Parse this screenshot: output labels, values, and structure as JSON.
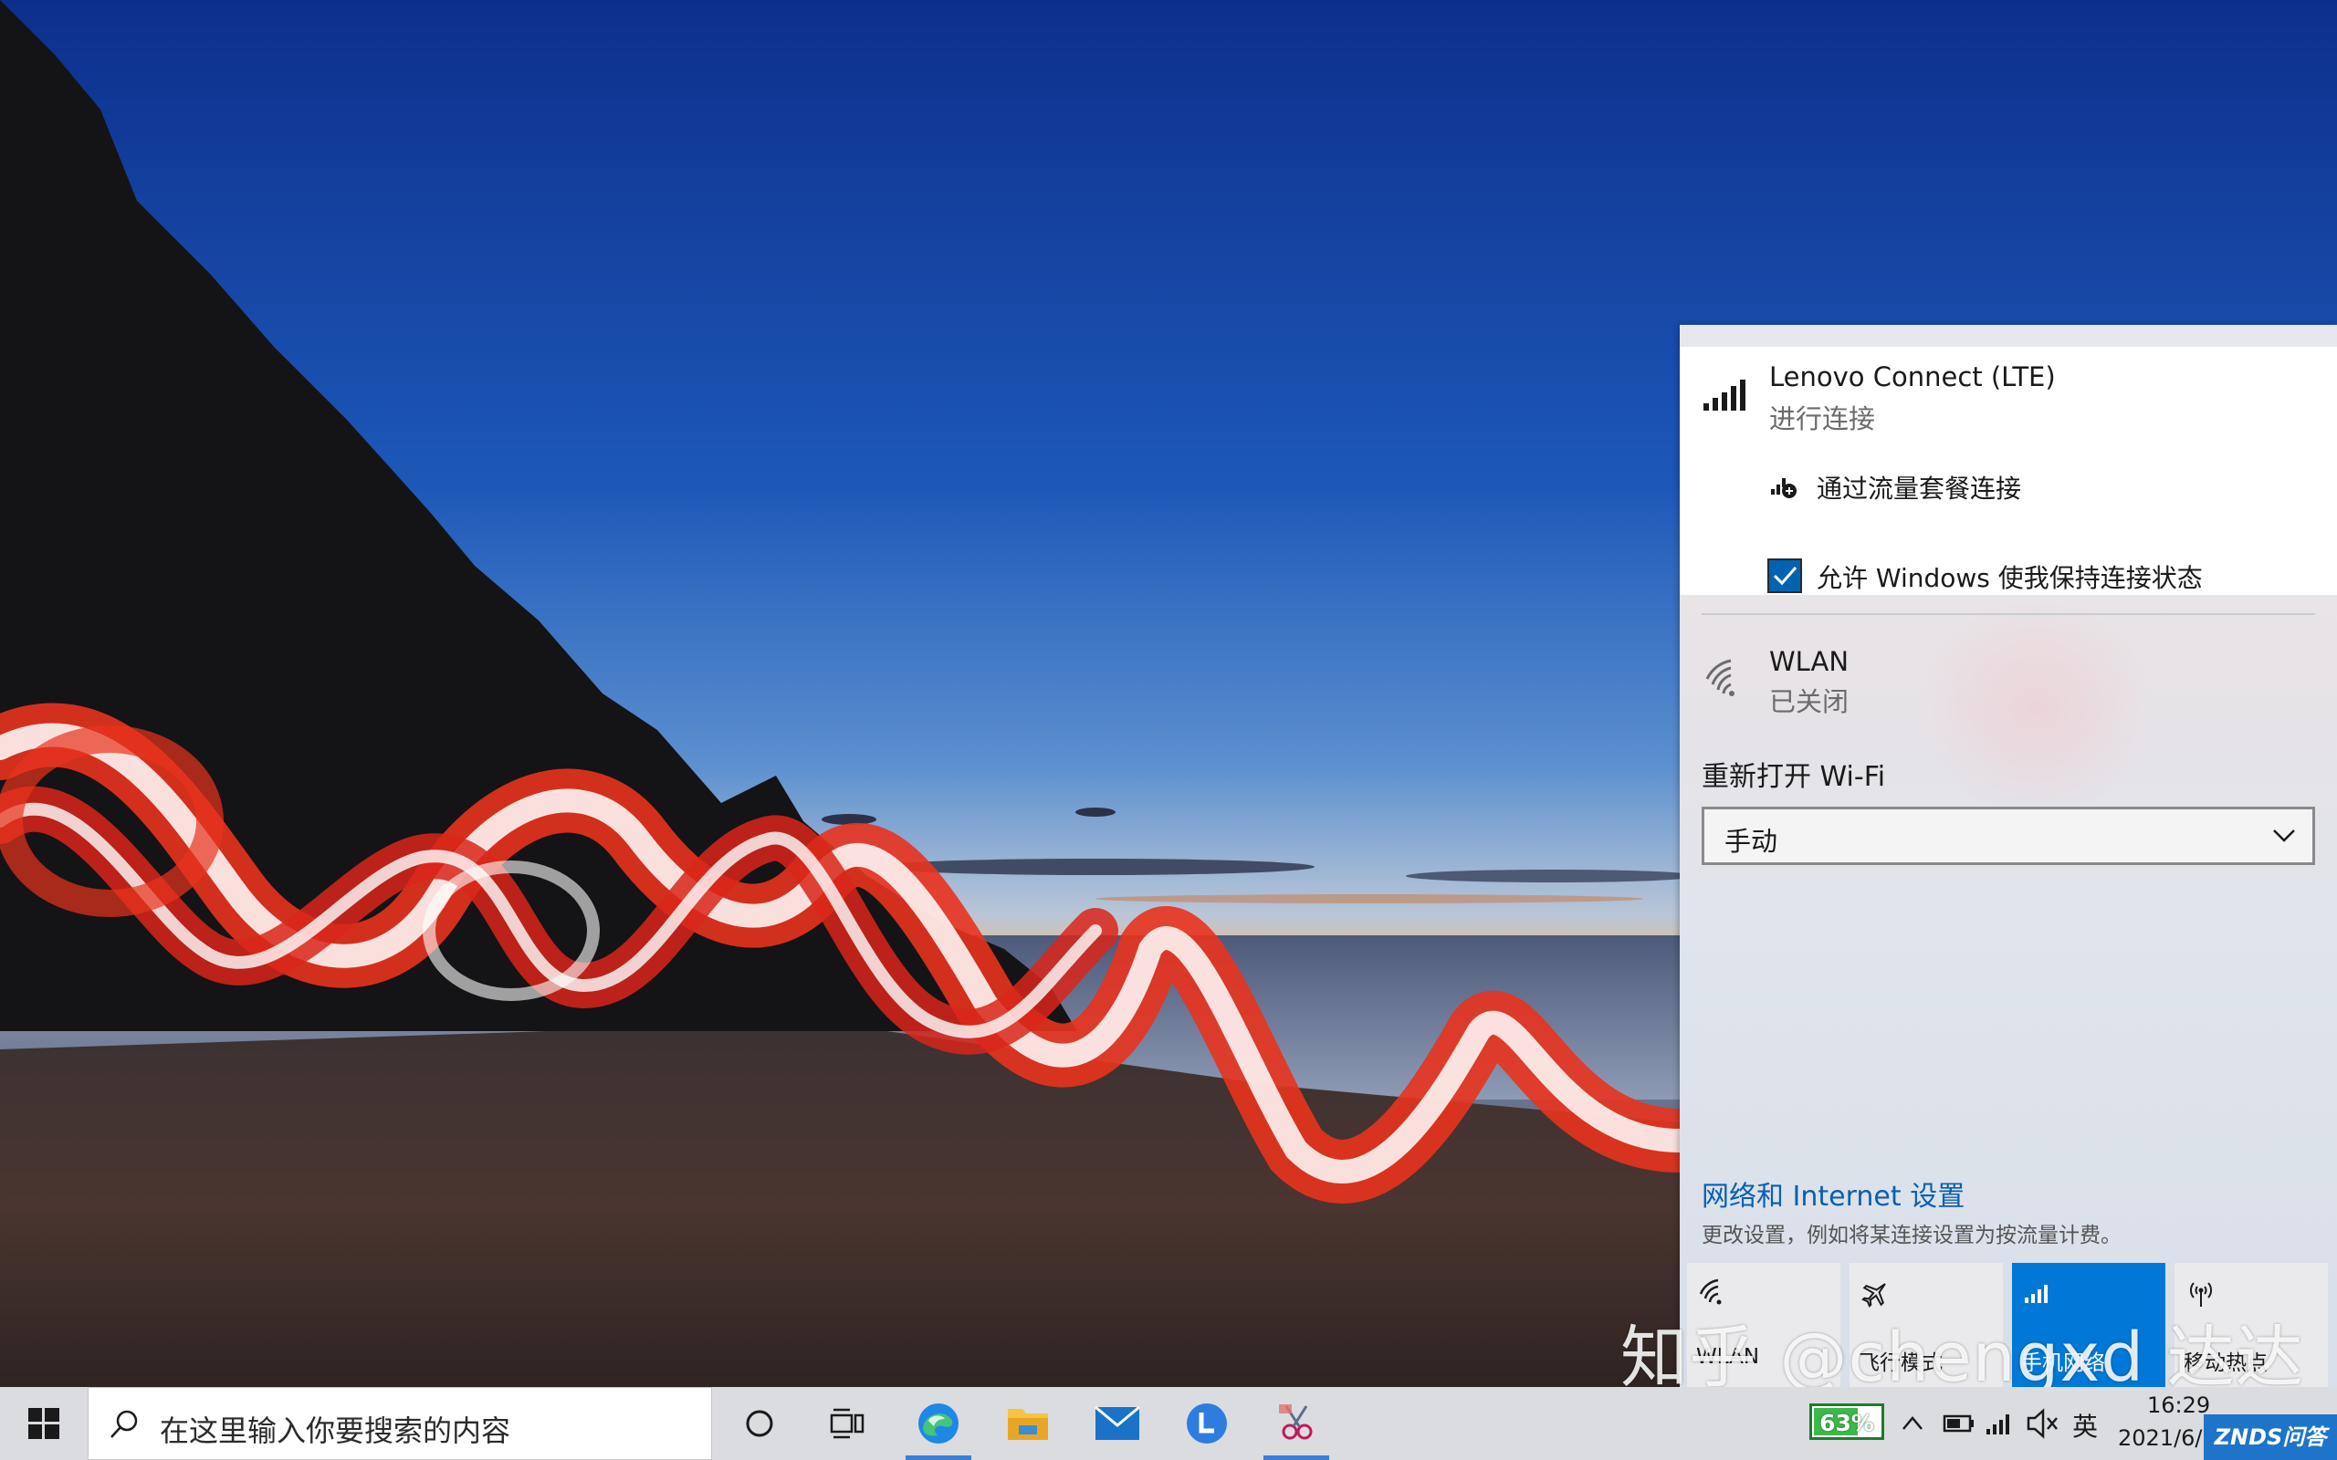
{
  "flyout": {
    "lte": {
      "name": "Lenovo Connect (LTE)",
      "status": "进行连接",
      "option_label": "通过流量套餐连接",
      "checkbox_label": "允许 Windows 使我保持连接状态",
      "checkbox_checked": true
    },
    "wlan": {
      "name": "WLAN",
      "status": "已关闭"
    },
    "wifi_reopen": {
      "label": "重新打开 Wi-Fi",
      "value": "手动"
    },
    "settings": {
      "link": "网络和 Internet 设置",
      "description": "更改设置，例如将某连接设置为按流量计费。"
    },
    "quick_actions": [
      {
        "label": "WLAN",
        "icon": "wifi-icon",
        "active": false
      },
      {
        "label": "飞行模式",
        "icon": "airplane-icon",
        "active": false
      },
      {
        "label": "手机网络",
        "icon": "cellular-icon",
        "active": true
      },
      {
        "label": "移动热点",
        "icon": "hotspot-icon",
        "active": false
      }
    ]
  },
  "taskbar": {
    "search_placeholder": "在这里输入你要搜索的内容",
    "apps": [
      "edge-icon",
      "file-explorer-icon",
      "mail-icon",
      "lenovo-app-icon",
      "snipping-tool-icon"
    ],
    "battery_percent": "63%",
    "ime": "英",
    "time": "16:29",
    "date": "2021/6/"
  },
  "overlay": {
    "watermark": "知乎 @chengxd 达达",
    "corner_badge": "ZNDS问答"
  },
  "colors": {
    "accent": "#0078d7",
    "link": "#0a5fb0"
  }
}
